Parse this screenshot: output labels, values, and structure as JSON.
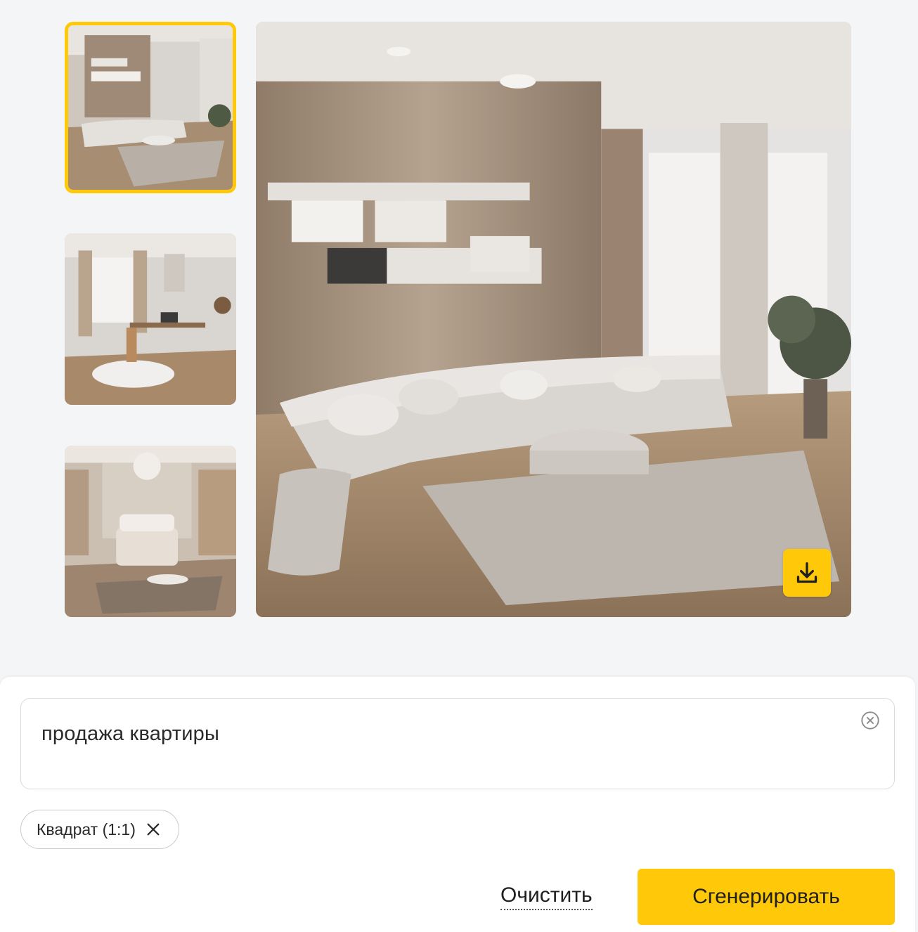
{
  "gallery": {
    "selected_index": 0,
    "thumbnails": [
      {
        "icon": "living-room-image"
      },
      {
        "icon": "study-room-image"
      },
      {
        "icon": "bedroom-image"
      }
    ],
    "download_icon": "download-icon"
  },
  "prompt": {
    "text": "продажа квартиры",
    "clear_icon": "clear-circle-icon"
  },
  "format_chip": {
    "label": "Квадрат (1:1)",
    "remove_icon": "close-icon"
  },
  "actions": {
    "clear_label": "Очистить",
    "generate_label": "Сгенерировать"
  },
  "colors": {
    "accent": "#ffc90a",
    "background": "#f4f5f7",
    "panel": "#ffffff"
  }
}
